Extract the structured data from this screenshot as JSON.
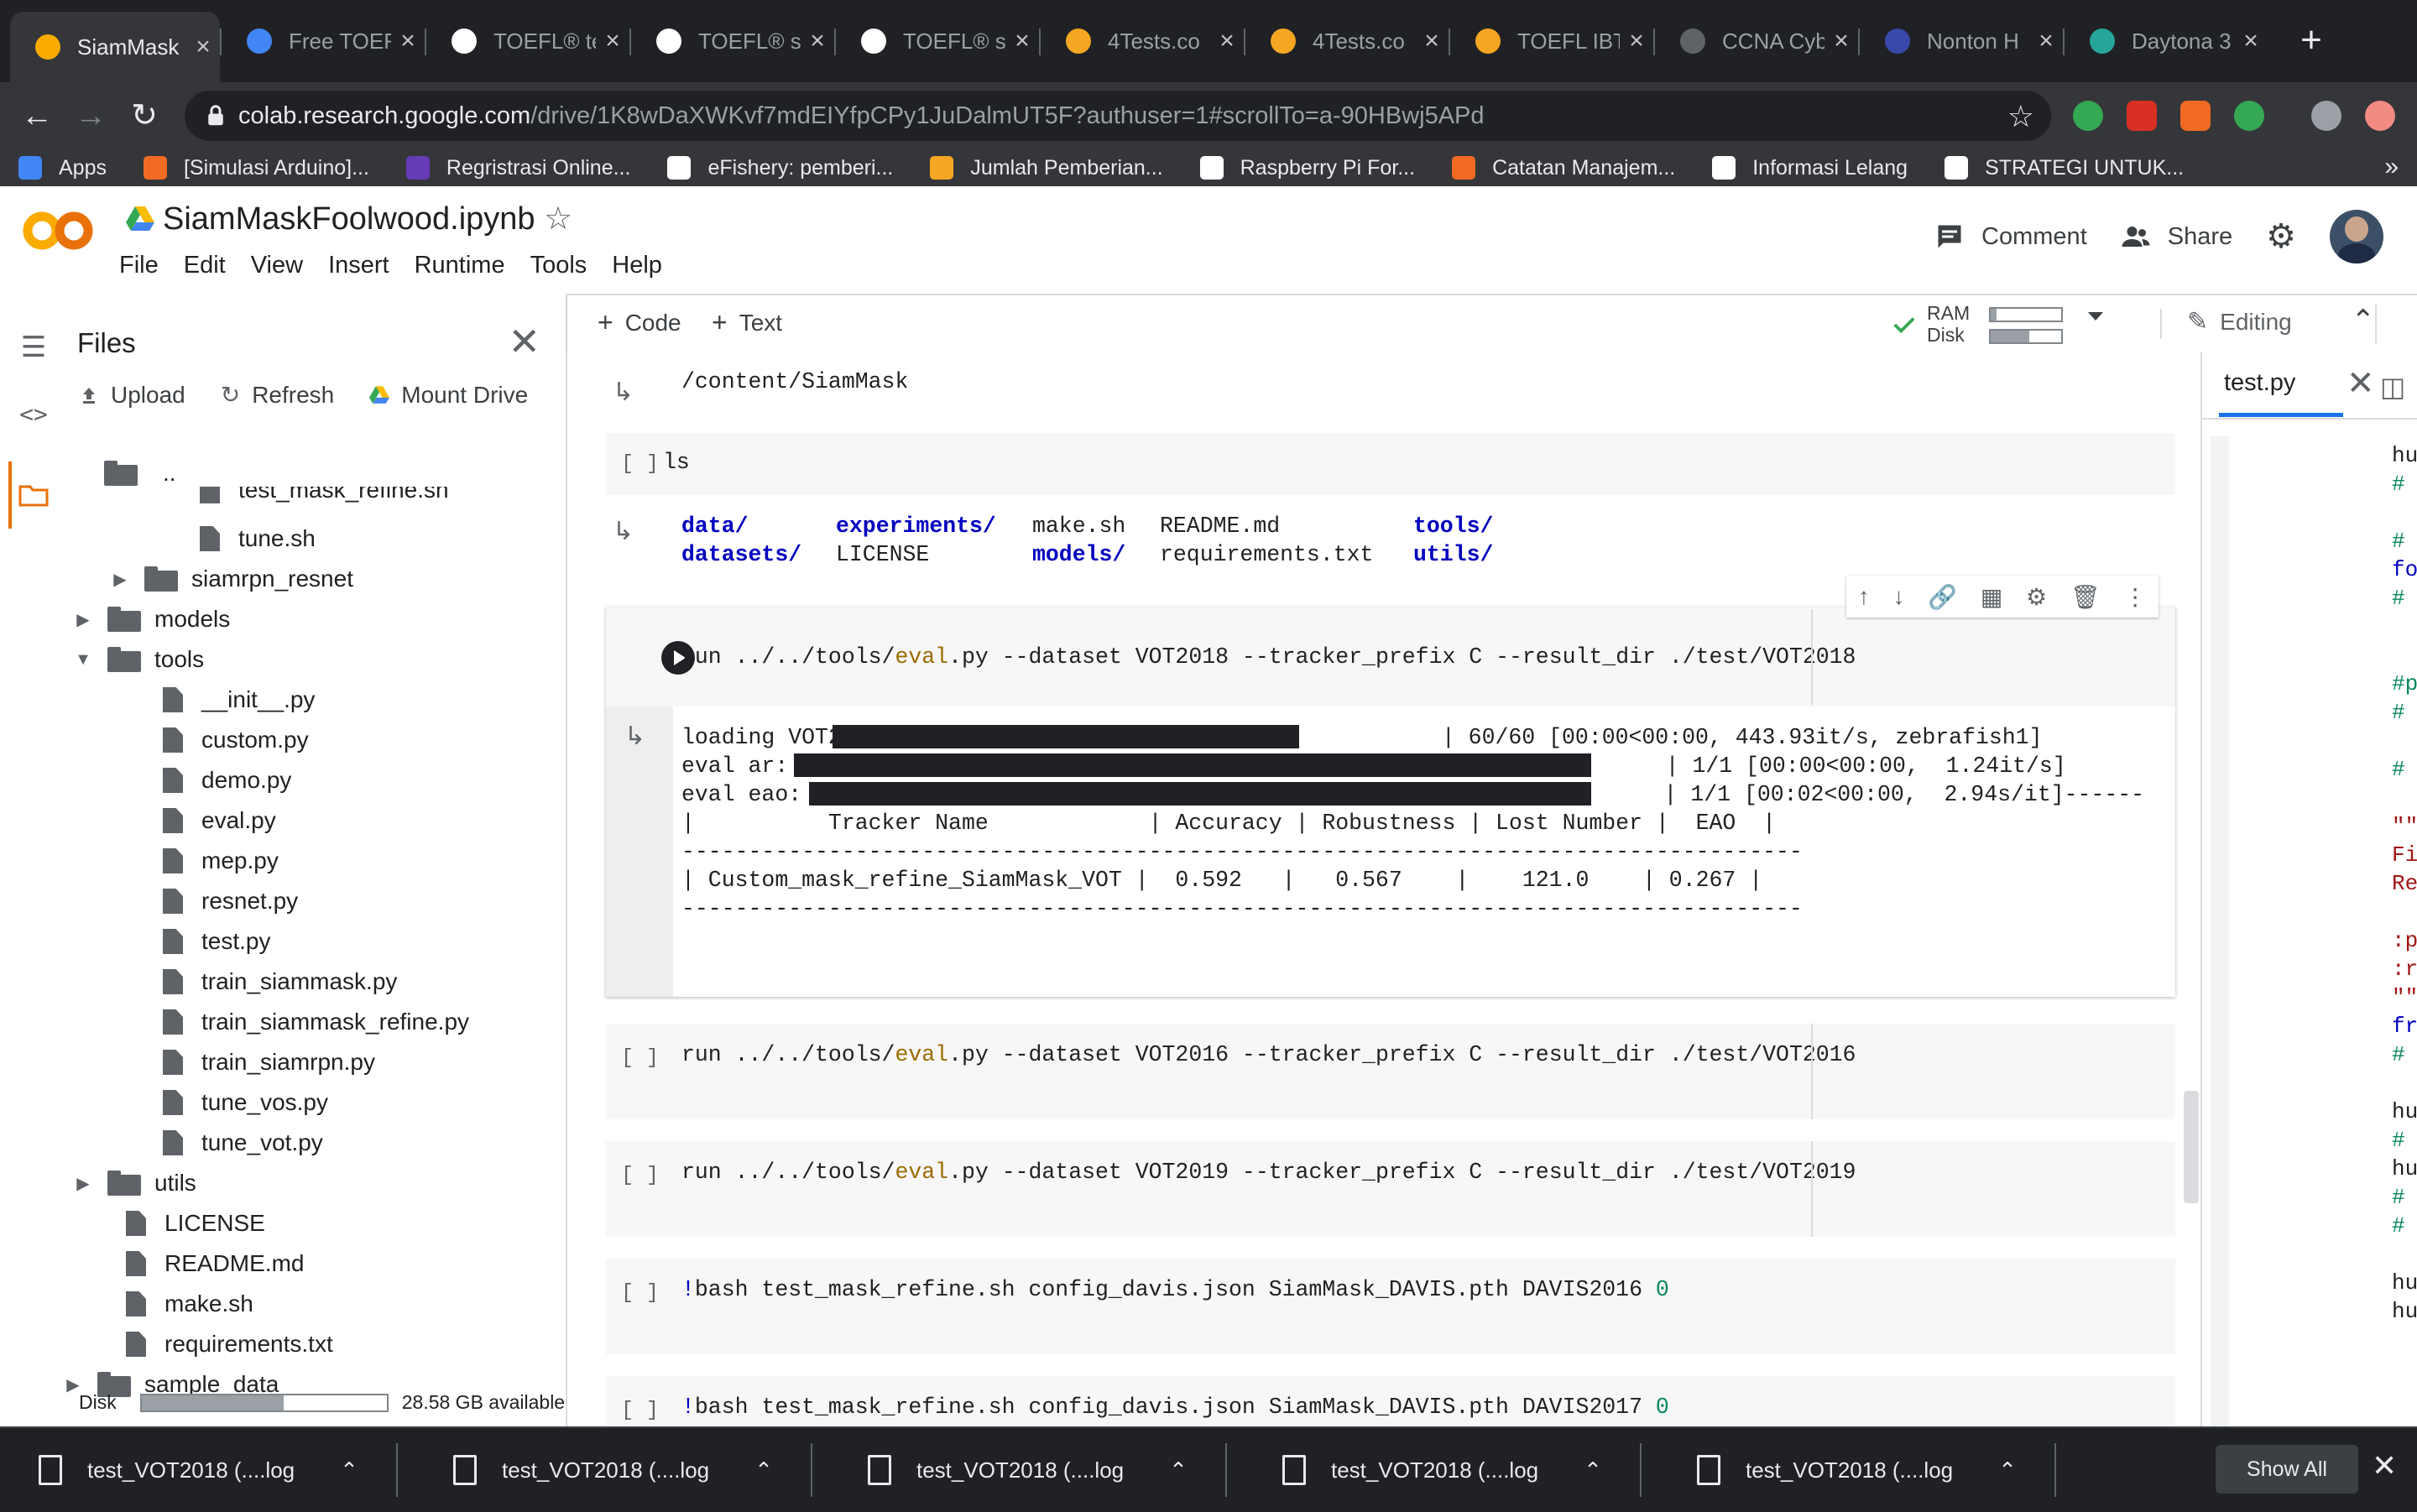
{
  "browser": {
    "tabs": [
      {
        "title": "SiamMask",
        "active": true
      },
      {
        "title": "Free TOEF",
        "active": false
      },
      {
        "title": "TOEFL® te",
        "active": false
      },
      {
        "title": "TOEFL® st",
        "active": false
      },
      {
        "title": "TOEFL® st",
        "active": false
      },
      {
        "title": "4Tests.co",
        "active": false
      },
      {
        "title": "4Tests.co",
        "active": false
      },
      {
        "title": "TOEFL IBT",
        "active": false
      },
      {
        "title": "CCNA Cyb",
        "active": false
      },
      {
        "title": "Nonton H",
        "active": false
      },
      {
        "title": "Daytona 3",
        "active": false
      }
    ],
    "url_host": "colab.research.google.com",
    "url_rest": "/drive/1K8wDaXWKvf7mdEIYfpCPy1JuDalmUT5F?authuser=1#scrollTo=a-90HBwj5APd",
    "bookmarks": [
      {
        "label": "Apps",
        "color": "#4285f4"
      },
      {
        "label": "[Simulasi Arduino]...",
        "color": "#f06a22"
      },
      {
        "label": "Regristrasi Online...",
        "color": "#673ab7"
      },
      {
        "label": "eFishery: pemberi...",
        "color": "#ffffff"
      },
      {
        "label": "Jumlah Pemberian...",
        "color": "#f5a623"
      },
      {
        "label": "Raspberry Pi For...",
        "color": "#ffffff"
      },
      {
        "label": "Catatan Manajem...",
        "color": "#f06a22"
      },
      {
        "label": "Informasi Lelang",
        "color": "#ffffff"
      },
      {
        "label": "STRATEGI UNTUK...",
        "color": "#ffffff"
      }
    ],
    "bookmarks_more": "»"
  },
  "colab": {
    "notebook_title": "SiamMaskFoolwood.ipynb",
    "menu": [
      "File",
      "Edit",
      "View",
      "Insert",
      "Runtime",
      "Tools",
      "Help"
    ],
    "comment_label": "Comment",
    "share_label": "Share",
    "add_code": "Code",
    "add_text": "Text",
    "ram_label": "RAM",
    "disk_label": "Disk",
    "ram_fraction": 0.08,
    "disk_fraction": 0.55,
    "editing_label": "Editing",
    "accent": "#e8710a"
  },
  "files": {
    "title": "Files",
    "upload": "Upload",
    "refresh": "Refresh",
    "mount": "Mount Drive",
    "tree": [
      {
        "name": "..",
        "kind": "up"
      },
      {
        "name": "test_mask_refine.sh",
        "kind": "file"
      },
      {
        "name": "tune.sh",
        "kind": "file"
      },
      {
        "name": "siamrpn_resnet",
        "kind": "folder"
      },
      {
        "name": "models",
        "kind": "folder"
      },
      {
        "name": "tools",
        "kind": "folder-open"
      },
      {
        "name": "__init__.py",
        "kind": "file"
      },
      {
        "name": "custom.py",
        "kind": "file"
      },
      {
        "name": "demo.py",
        "kind": "file"
      },
      {
        "name": "eval.py",
        "kind": "file"
      },
      {
        "name": "mep.py",
        "kind": "file"
      },
      {
        "name": "resnet.py",
        "kind": "file"
      },
      {
        "name": "test.py",
        "kind": "file"
      },
      {
        "name": "train_siammask.py",
        "kind": "file"
      },
      {
        "name": "train_siammask_refine.py",
        "kind": "file"
      },
      {
        "name": "train_siamrpn.py",
        "kind": "file"
      },
      {
        "name": "tune_vos.py",
        "kind": "file"
      },
      {
        "name": "tune_vot.py",
        "kind": "file"
      },
      {
        "name": "utils",
        "kind": "folder"
      },
      {
        "name": "LICENSE",
        "kind": "file"
      },
      {
        "name": "README.md",
        "kind": "file"
      },
      {
        "name": "make.sh",
        "kind": "file"
      },
      {
        "name": "requirements.txt",
        "kind": "file"
      },
      {
        "name": "sample_data",
        "kind": "folder"
      }
    ],
    "disk_label": "Disk",
    "disk_available": "28.58 GB available",
    "disk_fraction": 0.58
  },
  "notebook": {
    "prev_output": "/content/SiamMask",
    "ls_cell": {
      "bracket": "[ ]",
      "code": "ls"
    },
    "ls_output": {
      "row1": [
        {
          "text": "data/",
          "dir": true
        },
        {
          "text": "experiments/",
          "dir": true
        },
        {
          "text": "make.sh",
          "dir": false
        },
        {
          "text": "README.md",
          "dir": false
        },
        {
          "text": "tools/",
          "dir": true
        }
      ],
      "row2": [
        {
          "text": "datasets/",
          "dir": true
        },
        {
          "text": "LICENSE",
          "dir": false
        },
        {
          "text": "models/",
          "dir": true
        },
        {
          "text": "requirements.txt",
          "dir": false
        },
        {
          "text": "utils/",
          "dir": true
        }
      ]
    },
    "eval_cell": {
      "pre": "run ../../tools/",
      "kw": "eval",
      "post": ".py --dataset VOT2018 --tracker_prefix C --result_dir ./test/VOT2018"
    },
    "eval_output": {
      "line1_pre": "loading VOT2018: 100%|",
      "line1_post": "| 60/60 [00:00<00:00, 443.93it/s, zebrafish1]",
      "line2_pre": "eval ar: 100%|",
      "line2_post": "| 1/1 [00:00<00:00,  1.24it/s]",
      "line3_pre": "eval eao: 100%|",
      "line3_post": "| 1/1 [00:02<00:00,  2.94s/it]------",
      "table_header": "|          Tracker Name            | Accuracy | Robustness | Lost Number |  EAO  |",
      "separator": "------------------------------------------------------------------------------------",
      "table_row": "| Custom_mask_refine_SiamMask_VOT |  0.592   |   0.567    |    121.0    | 0.267 |"
    },
    "cells": [
      {
        "bracket": "[ ]",
        "pre": "run ../../tools/",
        "kw": "eval",
        "post": ".py --dataset VOT2016 --tracker_prefix C --result_dir ./test/VOT2016"
      },
      {
        "bracket": "[ ]",
        "pre": "run ../../tools/",
        "kw": "eval",
        "post": ".py --dataset VOT2019 --tracker_prefix C --result_dir ./test/VOT2019"
      },
      {
        "bracket": "[ ]",
        "bang": "!",
        "pre": "bash test_mask_refine.sh config_davis.json SiamMask_DAVIS.pth DAVIS2016 ",
        "num": "0"
      },
      {
        "bracket": "[ ]",
        "bang": "!",
        "pre": "bash test_mask_refine.sh config_davis.json SiamMask_DAVIS.pth DAVIS2017 ",
        "num": "0"
      }
    ]
  },
  "editor": {
    "tab_title": "test.py",
    "lines": [
      {
        "text": "hu",
        "color": "#202124"
      },
      {
        "text": "#",
        "color": "#09885a"
      },
      {
        "text": "",
        "color": "#202124"
      },
      {
        "text": "#",
        "color": "#09885a"
      },
      {
        "text": "fo",
        "color": "#0000c0"
      },
      {
        "text": "#",
        "color": "#09885a"
      },
      {
        "text": "",
        "color": "#202124"
      },
      {
        "text": "",
        "color": "#202124"
      },
      {
        "text": "#p",
        "color": "#09885a"
      },
      {
        "text": "#",
        "color": "#09885a"
      },
      {
        "text": "",
        "color": "#202124"
      },
      {
        "text": "#",
        "color": "#09885a"
      },
      {
        "text": "",
        "color": "#202124"
      },
      {
        "text": "\"\"",
        "color": "#a31515"
      },
      {
        "text": "Fi",
        "color": "#a31515"
      },
      {
        "text": "Re",
        "color": "#a31515"
      },
      {
        "text": "",
        "color": "#202124"
      },
      {
        "text": ":p",
        "color": "#a31515"
      },
      {
        "text": ":r",
        "color": "#a31515"
      },
      {
        "text": "\"\"",
        "color": "#a31515"
      },
      {
        "text": "fr",
        "color": "#0000c0"
      },
      {
        "text": "#",
        "color": "#09885a"
      },
      {
        "text": "",
        "color": "#202124"
      },
      {
        "text": "hu",
        "color": "#202124"
      },
      {
        "text": "#",
        "color": "#09885a"
      },
      {
        "text": "hu",
        "color": "#202124"
      },
      {
        "text": "#",
        "color": "#09885a"
      },
      {
        "text": "#",
        "color": "#09885a"
      },
      {
        "text": "",
        "color": "#202124"
      },
      {
        "text": "hu",
        "color": "#202124"
      },
      {
        "text": "hu",
        "color": "#202124"
      }
    ]
  },
  "downloads": {
    "items": [
      "test_VOT2018 (....log",
      "test_VOT2018 (....log",
      "test_VOT2018 (....log",
      "test_VOT2018 (....log",
      "test_VOT2018 (....log"
    ],
    "show_all": "Show All"
  }
}
